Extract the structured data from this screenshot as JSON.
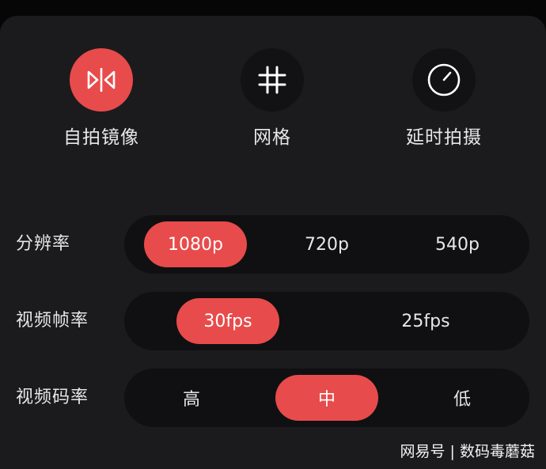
{
  "quick_actions": [
    {
      "label": "自拍镜像",
      "icon": "mirror-icon",
      "active": true
    },
    {
      "label": "网格",
      "icon": "grid-icon",
      "active": false
    },
    {
      "label": "延时拍摄",
      "icon": "timer-icon",
      "active": false
    }
  ],
  "settings": {
    "resolution": {
      "label": "分辨率",
      "options": [
        "1080p",
        "720p",
        "540p"
      ],
      "selected": "1080p"
    },
    "frame_rate": {
      "label": "视频帧率",
      "options": [
        "30fps",
        "25fps"
      ],
      "selected": "30fps"
    },
    "bitrate": {
      "label": "视频码率",
      "options": [
        "高",
        "中",
        "低"
      ],
      "selected": "中"
    }
  },
  "watermark": "网易号 | 数码毒蘑菇",
  "colors": {
    "accent": "#e84b4b",
    "panel": "#1b1b1d",
    "track": "#101012",
    "text": "#e7e7e9"
  }
}
